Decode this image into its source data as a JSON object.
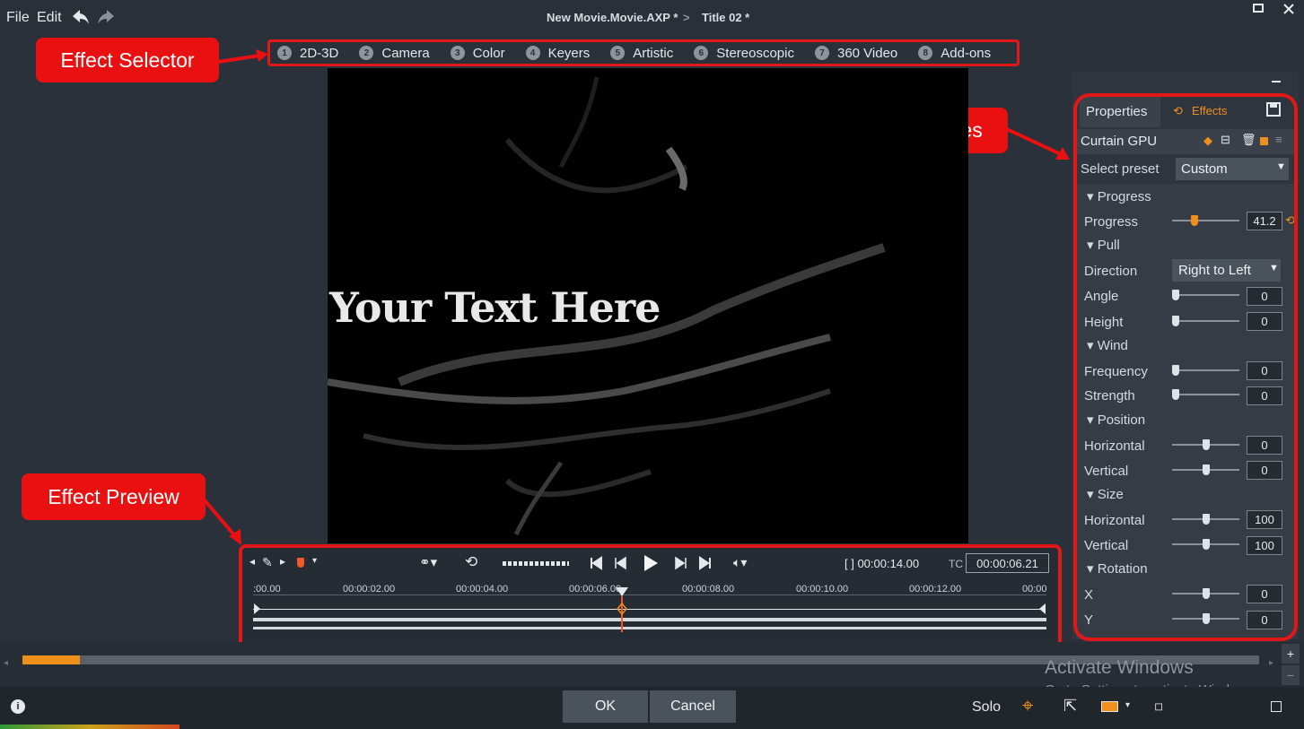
{
  "menu": {
    "file": "File",
    "edit": "Edit"
  },
  "breadcrumb": {
    "project": "New Movie.Movie.AXP *",
    "separator": ">",
    "title": "Title 02 *"
  },
  "effect_categories": [
    {
      "num": "1",
      "label": "2D-3D"
    },
    {
      "num": "2",
      "label": "Camera"
    },
    {
      "num": "3",
      "label": "Color"
    },
    {
      "num": "4",
      "label": "Keyers"
    },
    {
      "num": "5",
      "label": "Artistic"
    },
    {
      "num": "6",
      "label": "Stereoscopic"
    },
    {
      "num": "7",
      "label": "360 Video"
    },
    {
      "num": "8",
      "label": "Add-ons"
    }
  ],
  "callouts": {
    "selector": "Effect Selector",
    "properties": "Effect Properties",
    "preview": "Effect Preview"
  },
  "preview": {
    "text": "Your Text Here"
  },
  "transport": {
    "duration": "[ ] 00:00:14.00",
    "tc_label": "TC",
    "timecode": "00:00:06.21",
    "ticks": [
      ":00.00",
      "00:00:02.00",
      "00:00:04.00",
      "00:00:06.00",
      "00:00:08.00",
      "00:00:10.00",
      "00:00:12.00",
      "00:00"
    ],
    "playhead_fraction": 0.465
  },
  "panel": {
    "tabs": {
      "properties": "Properties",
      "effects": "Effects"
    },
    "effect_name": "Curtain GPU",
    "preset_label": "Select preset",
    "preset_value": "Custom",
    "sections": {
      "progress": "Progress",
      "pull": "Pull",
      "wind": "Wind",
      "position": "Position",
      "size": "Size",
      "rotation": "Rotation"
    },
    "rows": {
      "progress": {
        "label": "Progress",
        "value": "41.2",
        "fraction": 0.31
      },
      "direction_label": "Direction",
      "direction_value": "Right to Left",
      "angle": {
        "label": "Angle",
        "value": "0",
        "fraction": 0
      },
      "height": {
        "label": "Height",
        "value": "0",
        "fraction": 0
      },
      "frequency": {
        "label": "Frequency",
        "value": "0",
        "fraction": 0
      },
      "strength": {
        "label": "Strength",
        "value": "0",
        "fraction": 0
      },
      "pos_h": {
        "label": "Horizontal",
        "value": "0",
        "fraction": 0.5
      },
      "pos_v": {
        "label": "Vertical",
        "value": "0",
        "fraction": 0.5
      },
      "size_h": {
        "label": "Horizontal",
        "value": "100",
        "fraction": 0.5
      },
      "size_v": {
        "label": "Vertical",
        "value": "100",
        "fraction": 0.5
      },
      "rot_x": {
        "label": "X",
        "value": "0",
        "fraction": 0.5
      },
      "rot_y": {
        "label": "Y",
        "value": "0",
        "fraction": 0.5
      }
    }
  },
  "bottom": {
    "ok": "OK",
    "cancel": "Cancel",
    "solo": "Solo",
    "watermark_title": "Activate Windows",
    "watermark_sub": "Go to Settings to activate Windows."
  },
  "colors": {
    "accent": "#f0901c",
    "callout": "#e81010",
    "background": "#2b313a"
  }
}
